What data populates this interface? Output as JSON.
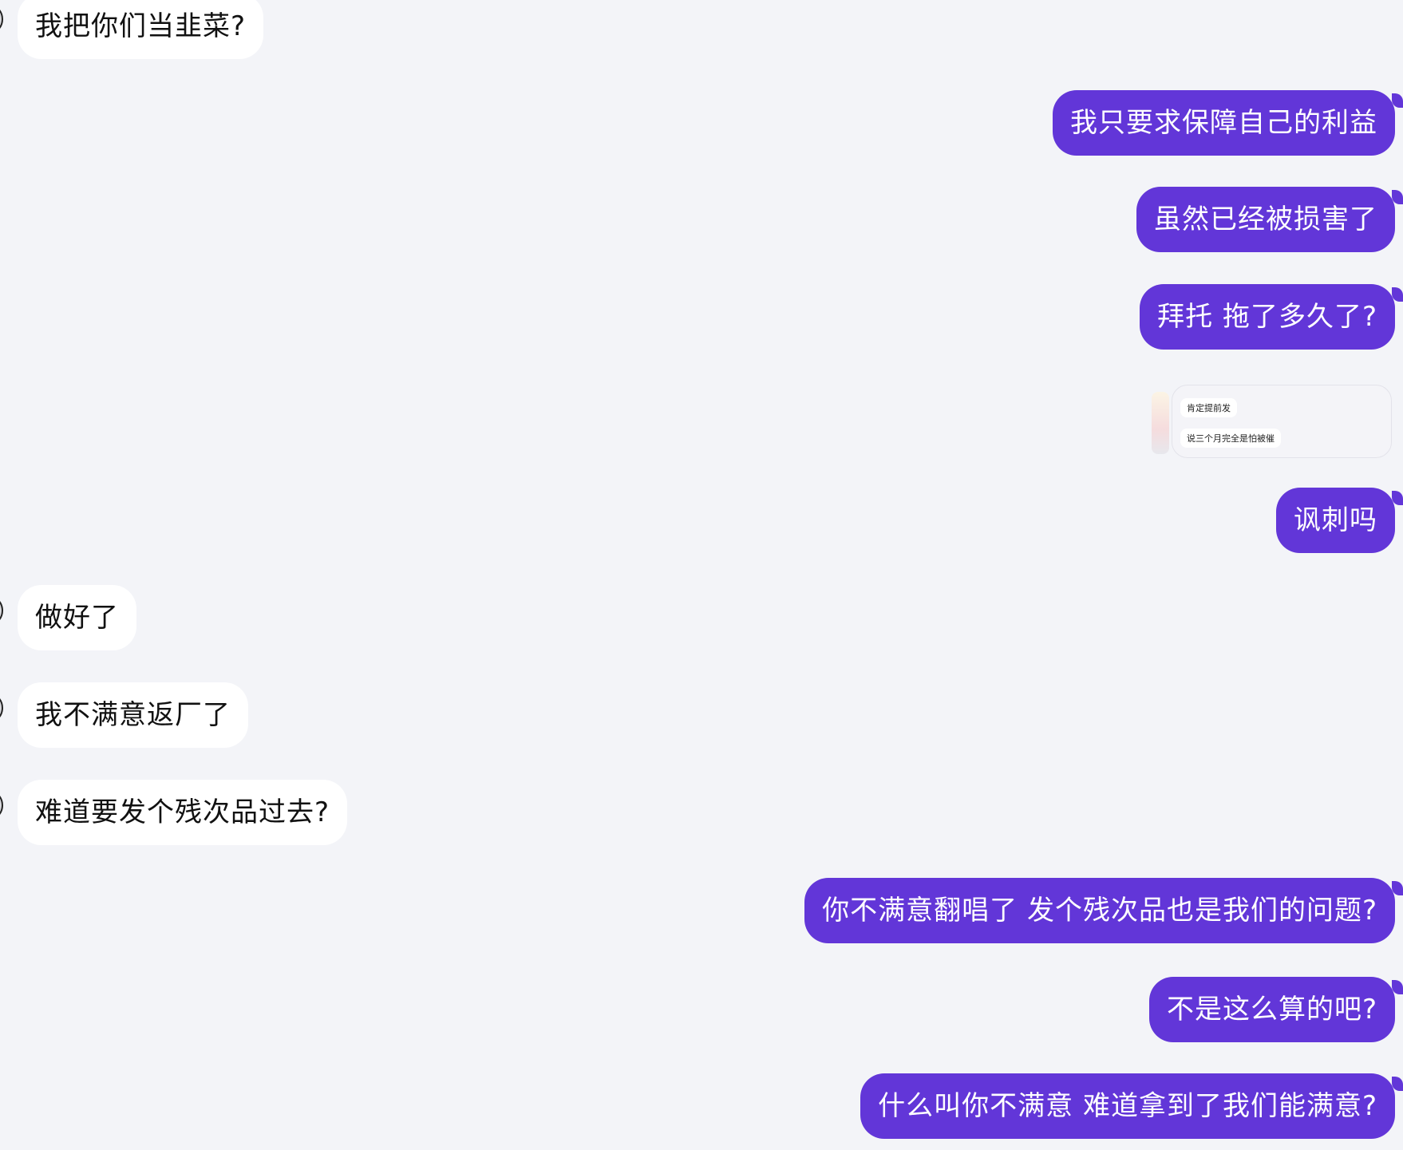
{
  "messages": [
    {
      "side": "in",
      "text": "我把你们当韭菜?"
    },
    {
      "side": "out",
      "text": "我只要求保障自己的利益"
    },
    {
      "side": "out",
      "text": "虽然已经被损害了"
    },
    {
      "side": "out",
      "text": "拜托 拖了多久了?"
    },
    {
      "side": "image",
      "lines": [
        "肯定提前发",
        "说三个月完全是怕被催"
      ]
    },
    {
      "side": "out",
      "text": "讽刺吗"
    },
    {
      "side": "in",
      "text": "做好了"
    },
    {
      "side": "in",
      "text": "我不满意返厂了"
    },
    {
      "side": "in",
      "text": "难道要发个残次品过去?"
    },
    {
      "side": "out",
      "text": "你不满意翻唱了 发个残次品也是我们的问题?"
    },
    {
      "side": "out",
      "text": "不是这么算的吧?"
    },
    {
      "side": "out",
      "text": "什么叫你不满意 难道拿到了我们能满意?"
    }
  ],
  "colors": {
    "background": "#f3f4f8",
    "incoming_bubble": "#ffffff",
    "outgoing_bubble": "#6236d8",
    "outgoing_text": "#ffffff",
    "incoming_text": "#111111"
  }
}
